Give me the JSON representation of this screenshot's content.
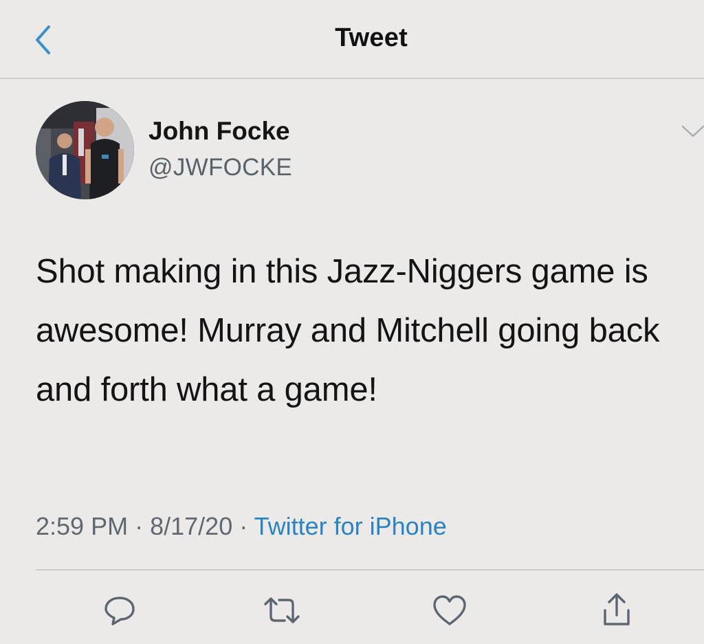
{
  "nav": {
    "title": "Tweet",
    "back_icon": "chevron-left-icon"
  },
  "tweet": {
    "author": {
      "name": "John Focke",
      "handle": "@JWFOCKE"
    },
    "text": "Shot making in this Jazz-Niggers game is awesome! Murray and Mitchell going back and forth what a game!",
    "time": "2:59 PM",
    "separator": "·",
    "date": "8/17/20",
    "source": "Twitter for iPhone"
  },
  "actions": [
    {
      "icon": "reply-icon"
    },
    {
      "icon": "retweet-icon"
    },
    {
      "icon": "like-icon"
    },
    {
      "icon": "share-icon"
    }
  ],
  "colors": {
    "background": "#eceae9",
    "link": "#2a84c3",
    "secondary_text": "#5f6871",
    "icon": "#5b6670"
  }
}
